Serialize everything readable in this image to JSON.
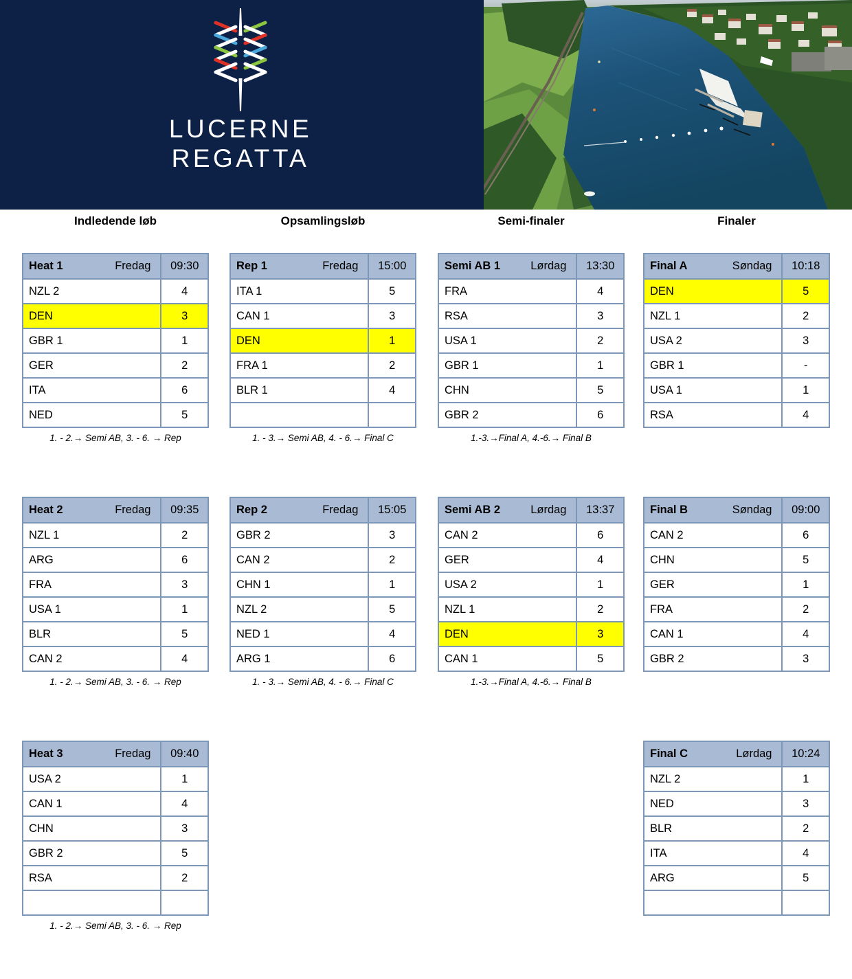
{
  "banner": {
    "logo_line1": "LUCERNE",
    "logo_line2": "REGATTA",
    "logo_icon": "lucerne-regatta-spire-logo",
    "photo_alt": "aerial-photo-rotsee-rowing-course",
    "navy": "#0d2147"
  },
  "colors": {
    "header_row": "#a9bbd4",
    "border": "#7d97b8",
    "highlight": "#ffff00"
  },
  "sections": [
    {
      "label": "Indledende løb"
    },
    {
      "label": "Opsamlingsløb"
    },
    {
      "label": "Semi-finaler"
    },
    {
      "label": "Finaler"
    }
  ],
  "races": [
    {
      "id": "heat-1",
      "title": "Heat 1",
      "day": "Fredag",
      "time": "09:30",
      "footnote": "1. - 2.→ Semi AB, 3. - 6. → Rep",
      "rows": [
        {
          "name": "NZL 2",
          "value": "4",
          "highlight": false
        },
        {
          "name": "DEN",
          "value": "3",
          "highlight": true
        },
        {
          "name": "GBR 1",
          "value": "1",
          "highlight": false
        },
        {
          "name": "GER",
          "value": "2",
          "highlight": false
        },
        {
          "name": "ITA",
          "value": "6",
          "highlight": false
        },
        {
          "name": "NED",
          "value": "5",
          "highlight": false
        }
      ]
    },
    {
      "id": "rep-1",
      "title": "Rep 1",
      "day": "Fredag",
      "time": "15:00",
      "footnote": "1. -  3.→ Semi AB, 4. -  6.→ Final C",
      "rows": [
        {
          "name": "ITA 1",
          "value": "5",
          "highlight": false
        },
        {
          "name": "CAN 1",
          "value": "3",
          "highlight": false
        },
        {
          "name": "DEN",
          "value": "1",
          "highlight": true
        },
        {
          "name": "FRA 1",
          "value": "2",
          "highlight": false
        },
        {
          "name": "BLR 1",
          "value": "4",
          "highlight": false
        },
        {
          "name": "",
          "value": "",
          "highlight": false
        }
      ]
    },
    {
      "id": "semi-ab-1",
      "title": "Semi AB 1",
      "day": "Lørdag",
      "time": "13:30",
      "footnote": "1.-3.→Final A, 4.-6.→ Final B",
      "rows": [
        {
          "name": "FRA",
          "value": "4",
          "highlight": false
        },
        {
          "name": "RSA",
          "value": "3",
          "highlight": false
        },
        {
          "name": "USA 1",
          "value": "2",
          "highlight": false
        },
        {
          "name": "GBR 1",
          "value": "1",
          "highlight": false
        },
        {
          "name": "CHN",
          "value": "5",
          "highlight": false
        },
        {
          "name": "GBR 2",
          "value": "6",
          "highlight": false
        }
      ]
    },
    {
      "id": "final-a",
      "title": "Final A",
      "day": "Søndag",
      "time": "10:18",
      "footnote": "",
      "rows": [
        {
          "name": "DEN",
          "value": "5",
          "highlight": true
        },
        {
          "name": "NZL 1",
          "value": "2",
          "highlight": false
        },
        {
          "name": "USA 2",
          "value": "3",
          "highlight": false
        },
        {
          "name": "GBR 1",
          "value": "-",
          "highlight": false
        },
        {
          "name": "USA 1",
          "value": "1",
          "highlight": false
        },
        {
          "name": "RSA",
          "value": "4",
          "highlight": false
        }
      ]
    },
    {
      "id": "heat-2",
      "title": "Heat 2",
      "day": "Fredag",
      "time": "09:35",
      "footnote": "1. - 2.→ Semi AB, 3. - 6. → Rep",
      "rows": [
        {
          "name": "NZL 1",
          "value": "2",
          "highlight": false
        },
        {
          "name": "ARG",
          "value": "6",
          "highlight": false
        },
        {
          "name": "FRA",
          "value": "3",
          "highlight": false
        },
        {
          "name": "USA 1",
          "value": "1",
          "highlight": false
        },
        {
          "name": "BLR",
          "value": "5",
          "highlight": false
        },
        {
          "name": "CAN 2",
          "value": "4",
          "highlight": false
        }
      ]
    },
    {
      "id": "rep-2",
      "title": "Rep 2",
      "day": "Fredag",
      "time": "15:05",
      "footnote": "1. -  3.→ Semi AB, 4. -  6.→ Final C",
      "rows": [
        {
          "name": "GBR 2",
          "value": "3",
          "highlight": false
        },
        {
          "name": "CAN 2",
          "value": "2",
          "highlight": false
        },
        {
          "name": "CHN 1",
          "value": "1",
          "highlight": false
        },
        {
          "name": "NZL 2",
          "value": "5",
          "highlight": false
        },
        {
          "name": "NED 1",
          "value": "4",
          "highlight": false
        },
        {
          "name": "ARG 1",
          "value": "6",
          "highlight": false
        }
      ]
    },
    {
      "id": "semi-ab-2",
      "title": "Semi AB 2",
      "day": "Lørdag",
      "time": "13:37",
      "footnote": "1.-3.→Final A, 4.-6.→ Final B",
      "rows": [
        {
          "name": "CAN 2",
          "value": "6",
          "highlight": false
        },
        {
          "name": "GER",
          "value": "4",
          "highlight": false
        },
        {
          "name": "USA 2",
          "value": "1",
          "highlight": false
        },
        {
          "name": "NZL 1",
          "value": "2",
          "highlight": false
        },
        {
          "name": "DEN",
          "value": "3",
          "highlight": true
        },
        {
          "name": "CAN 1",
          "value": "5",
          "highlight": false
        }
      ]
    },
    {
      "id": "final-b",
      "title": "Final B",
      "day": "Søndag",
      "time": "09:00",
      "footnote": "",
      "rows": [
        {
          "name": "CAN 2",
          "value": "6",
          "highlight": false
        },
        {
          "name": "CHN",
          "value": "5",
          "highlight": false
        },
        {
          "name": "GER",
          "value": "1",
          "highlight": false
        },
        {
          "name": "FRA",
          "value": "2",
          "highlight": false
        },
        {
          "name": "CAN 1",
          "value": "4",
          "highlight": false
        },
        {
          "name": "GBR 2",
          "value": "3",
          "highlight": false
        }
      ]
    },
    {
      "id": "heat-3",
      "title": "Heat 3",
      "day": "Fredag",
      "time": "09:40",
      "footnote": "1. - 2.→ Semi AB, 3. - 6. → Rep",
      "rows": [
        {
          "name": "USA 2",
          "value": "1",
          "highlight": false
        },
        {
          "name": "CAN 1",
          "value": "4",
          "highlight": false
        },
        {
          "name": "CHN",
          "value": "3",
          "highlight": false
        },
        {
          "name": "GBR 2",
          "value": "5",
          "highlight": false
        },
        {
          "name": "RSA",
          "value": "2",
          "highlight": false
        },
        {
          "name": "",
          "value": "",
          "highlight": false
        }
      ]
    },
    {
      "id": "final-c",
      "title": "Final C",
      "day": "Lørdag",
      "time": "10:24",
      "footnote": "",
      "rows": [
        {
          "name": "NZL 2",
          "value": "1",
          "highlight": false
        },
        {
          "name": "NED",
          "value": "3",
          "highlight": false
        },
        {
          "name": "BLR",
          "value": "2",
          "highlight": false
        },
        {
          "name": "ITA",
          "value": "4",
          "highlight": false
        },
        {
          "name": "ARG",
          "value": "5",
          "highlight": false
        },
        {
          "name": "",
          "value": "",
          "highlight": false
        }
      ]
    }
  ]
}
